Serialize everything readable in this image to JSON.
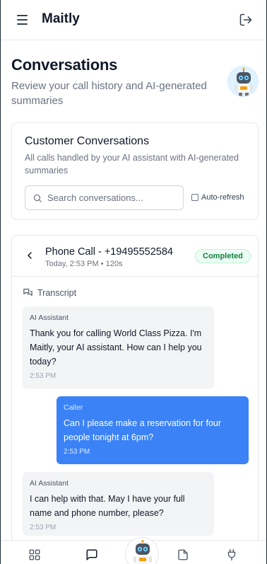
{
  "app": {
    "name": "Maitly"
  },
  "header": {
    "title": "Conversations",
    "subtitle": "Review your call history and AI-generated summaries"
  },
  "conversations_card": {
    "title": "Customer Conversations",
    "description": "All calls handled by your AI assistant with AI-generated summaries",
    "search_placeholder": "Search conversations...",
    "search_value": "",
    "auto_refresh_label": "Auto-refresh",
    "auto_refresh_checked": false
  },
  "call": {
    "title": "Phone Call - +19495552584",
    "meta": "Today, 2:53 PM • 120s",
    "status": "Completed",
    "transcript_label": "Transcript",
    "messages": [
      {
        "speaker": "AI Assistant",
        "text": "Thank you for calling World Class Pizza. I'm Maitly, your AI assistant. How can I help you today?",
        "time": "2:53 PM"
      },
      {
        "speaker": "Caller",
        "text": "Can I please make a reservation for four people tonight at 6pm?",
        "time": "2:53 PM"
      },
      {
        "speaker": "AI Assistant",
        "text": "I can help with that. May I have your full name and phone number, please?",
        "time": "2:53 PM"
      }
    ]
  },
  "bottom_nav": {
    "items": [
      "dashboard-icon",
      "conversations-icon",
      "assistant-avatar",
      "documents-icon",
      "integrations-icon"
    ],
    "active": "conversations-icon"
  },
  "colors": {
    "accent": "#3b82f6",
    "status_green": "#15803d",
    "ai_bubble": "#f3f4f6"
  }
}
